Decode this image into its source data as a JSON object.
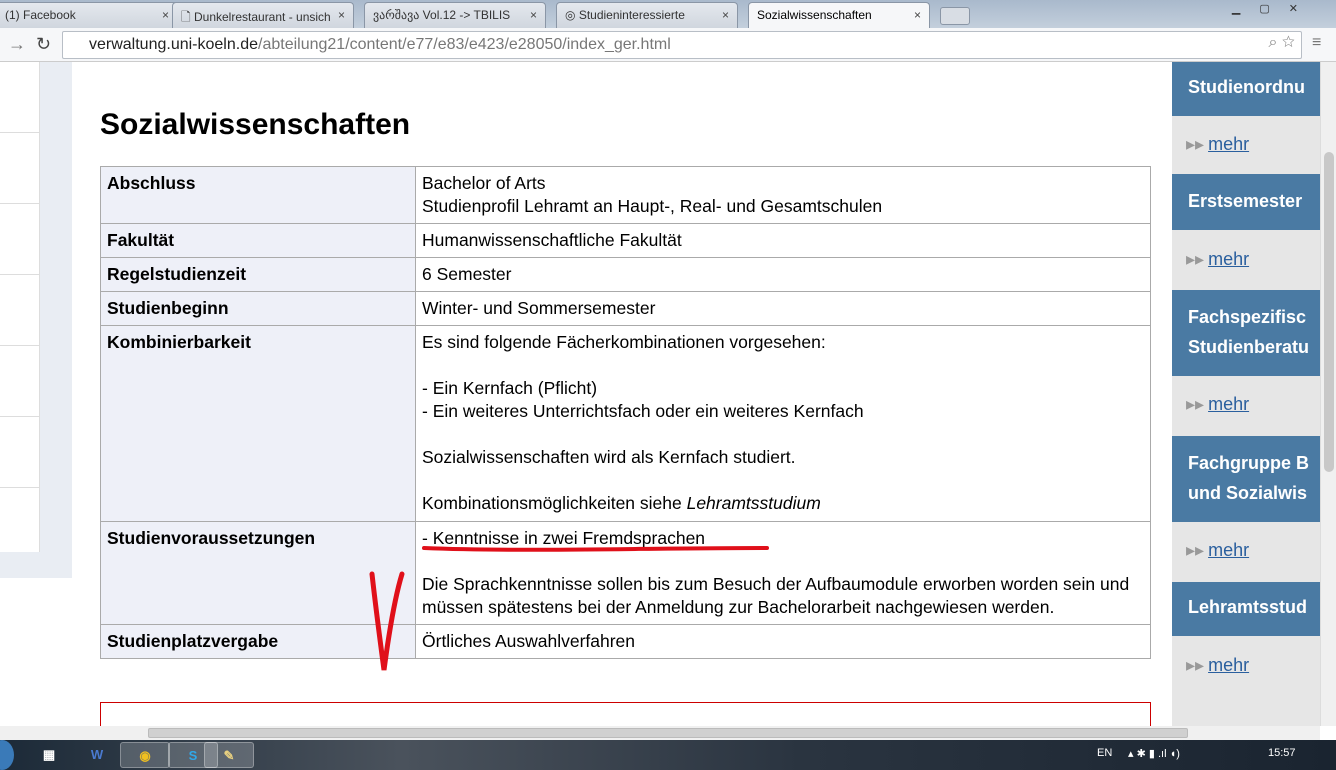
{
  "browser": {
    "tabs": [
      {
        "label": "(1) Facebook"
      },
      {
        "label": "Dunkelrestaurant - unsich"
      },
      {
        "label": "ვარშავა Vol.12 -> TBILIS"
      },
      {
        "label": "Studieninteressierte"
      },
      {
        "label": "Sozialwissenschaften",
        "active": true
      }
    ],
    "url_host": "verwaltung.uni-koeln.de",
    "url_path": "/abteilung21/content/e77/e83/e423/e28050/index_ger.html"
  },
  "page": {
    "title": "Sozialwissenschaften",
    "rows": [
      {
        "key": "Abschluss",
        "lines": [
          "Bachelor of Arts",
          "Studienprofil Lehramt an Haupt-, Real- und Gesamtschulen"
        ]
      },
      {
        "key": "Fakultät",
        "lines": [
          "Humanwissenschaftliche Fakultät"
        ]
      },
      {
        "key": "Regelstudienzeit",
        "lines": [
          "6 Semester"
        ]
      },
      {
        "key": "Studienbeginn",
        "lines": [
          "Winter- und Sommersemester"
        ]
      },
      {
        "key": "Kombinierbarkeit",
        "lines": [
          "Es sind folgende Fächerkombinationen vorgesehen:",
          "",
          "- Ein Kernfach (Pflicht)",
          "- Ein weiteres Unterrichtsfach oder ein weiteres Kernfach",
          "",
          "Sozialwissenschaften wird als Kernfach studiert.",
          ""
        ],
        "link_prefix": "Kombinationsmöglichkeiten siehe ",
        "link": "Lehramtsstudium"
      },
      {
        "key": "Studienvoraussetzungen",
        "lines": [
          "- Kenntnisse in zwei Fremdsprachen",
          "",
          "Die Sprachkenntnisse sollen bis zum Besuch der Aufbaumodule erworben worden sein und müssen spätestens bei der Anmeldung zur Bachelorarbeit nachgewiesen werden."
        ]
      },
      {
        "key": "Studienplatzvergabe",
        "lines": [
          "Örtliches Auswahlverfahren"
        ]
      }
    ]
  },
  "sidebar": {
    "blocks": [
      {
        "title": "Studienordnu",
        "more": "mehr"
      },
      {
        "title": "Erstsemester",
        "more": "mehr"
      },
      {
        "title": "Fachspezifisc Studienberatu",
        "l1": "Fachspezifisc",
        "l2": "Studienberatu",
        "more": "mehr"
      },
      {
        "title": "Fachgruppe B und Sozialwis",
        "l1": "Fachgruppe B",
        "l2": "und Sozialwis",
        "more": "mehr"
      },
      {
        "title": "Lehramtsstud",
        "more": "mehr"
      }
    ]
  },
  "taskbar": {
    "lang": "EN",
    "clock": "15:57",
    "apps": [
      "calculator",
      "word",
      "chrome",
      "skype",
      "paint"
    ]
  },
  "colors": {
    "sidebar_blue": "#4a7aa3",
    "annotation_red": "#e0101a"
  }
}
